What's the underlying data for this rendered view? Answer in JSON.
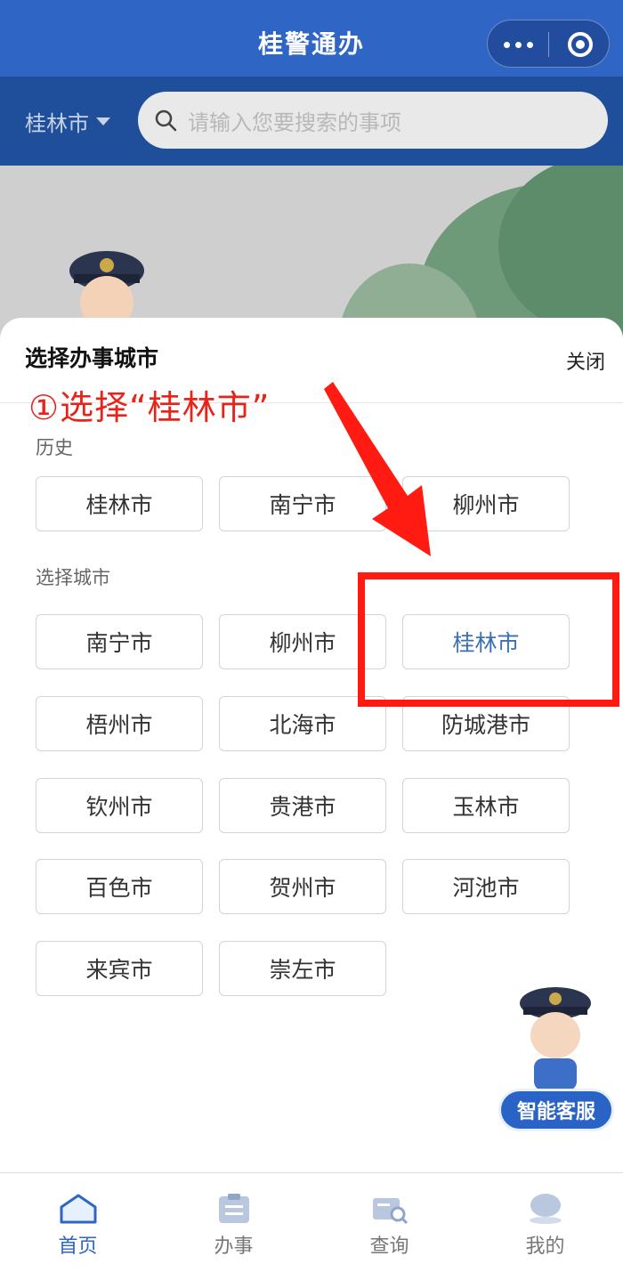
{
  "header": {
    "title": "桂警通办",
    "accent": "#2f66c5"
  },
  "search": {
    "city": "桂林市",
    "placeholder": "请输入您要搜索的事项"
  },
  "sheet": {
    "title": "选择办事城市",
    "close_label": "关闭",
    "history_label": "历史",
    "history": [
      "桂林市",
      "南宁市",
      "柳州市"
    ],
    "select_label": "选择城市",
    "cities": [
      "南宁市",
      "柳州市",
      "桂林市",
      "梧州市",
      "北海市",
      "防城港市",
      "钦州市",
      "贵港市",
      "玉林市",
      "百色市",
      "贺州市",
      "河池市",
      "来宾市",
      "崇左市"
    ],
    "selected_city": "桂林市"
  },
  "annotation": {
    "text": "①选择“桂林市”",
    "color": "#e8231a"
  },
  "assistant": {
    "label": "智能客服"
  },
  "tabs": [
    {
      "label": "首页",
      "icon": "home-icon",
      "active": true
    },
    {
      "label": "办事",
      "icon": "clipboard-icon",
      "active": false
    },
    {
      "label": "查询",
      "icon": "search-card-icon",
      "active": false
    },
    {
      "label": "我的",
      "icon": "user-icon",
      "active": false
    }
  ]
}
